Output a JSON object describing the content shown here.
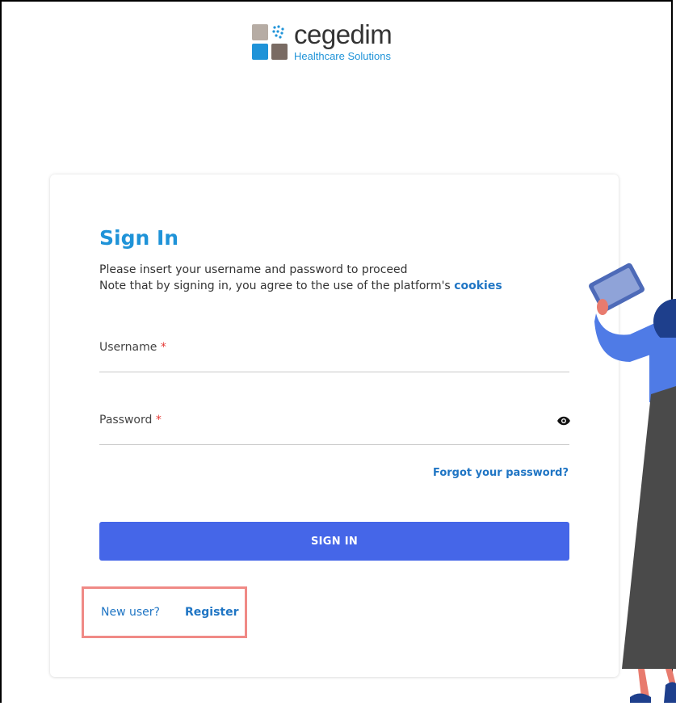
{
  "logo": {
    "brand": "cegedim",
    "tagline": "Healthcare Solutions"
  },
  "signin": {
    "title": "Sign In",
    "intro_line1": "Please insert your username and password to proceed",
    "intro_line2_prefix": "Note that by signing in, you agree to the use of the platform's ",
    "intro_link": "cookies",
    "username_label": "Username",
    "password_label": "Password",
    "required_mark": "*",
    "forgot_label": "Forgot your password?",
    "submit_label": "SIGN IN",
    "new_user_label": "New user?",
    "register_label": "Register"
  },
  "icons": {
    "password_toggle": "eye-icon"
  },
  "colors": {
    "accent": "#1f93d8",
    "link": "#1f75c4",
    "button": "#4566e8",
    "required": "#e53935",
    "highlight": "#f08a86"
  }
}
